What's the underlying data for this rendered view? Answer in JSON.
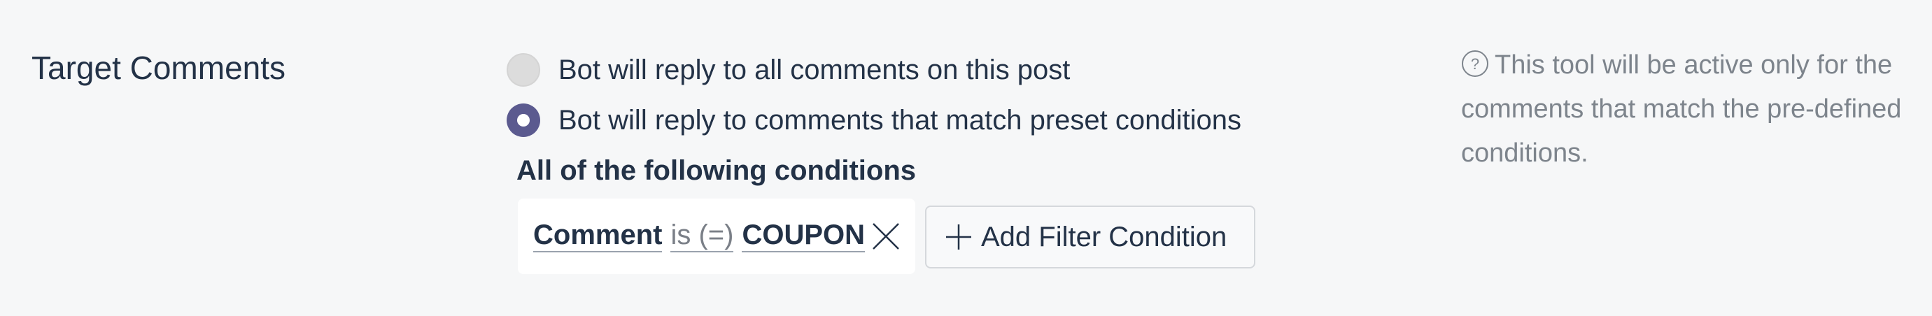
{
  "section": {
    "title": "Target Comments"
  },
  "options": [
    {
      "label": "Bot will reply to all comments on this post",
      "selected": false
    },
    {
      "label": "Bot will reply to comments that match preset conditions",
      "selected": true
    }
  ],
  "conditions": {
    "title": "All of the following conditions",
    "items": [
      {
        "field": "Comment",
        "operator": "is (=)",
        "value": "COUPON"
      }
    ],
    "add_button_label": "Add Filter Condition"
  },
  "help": {
    "text": "This tool will be active only for the comments that match the pre-defined conditions.",
    "icon": "question-circle-icon"
  },
  "colors": {
    "background": "#f6f7f8",
    "text_primary": "#233247",
    "text_muted": "#7d848c",
    "radio_selected": "#5b5a8f",
    "radio_unselected": "#dcdcdc"
  }
}
